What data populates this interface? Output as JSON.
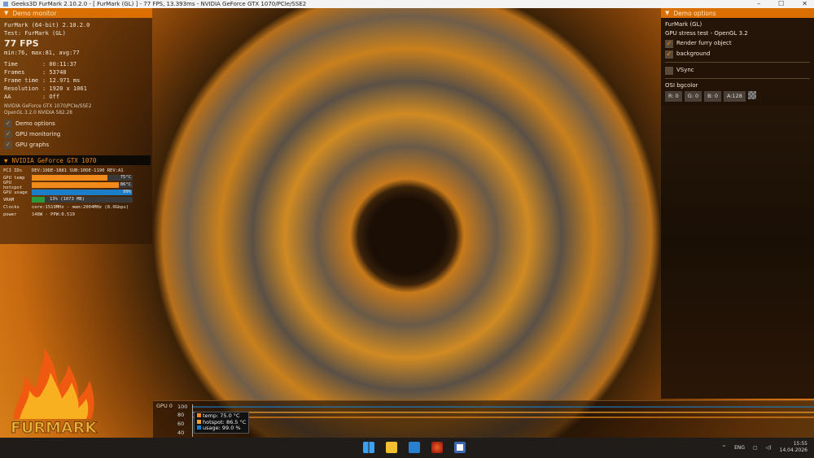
{
  "window": {
    "title": "Geeks3D FurMark 2.10.2.0 - [ FurMark (GL) ] - 77 FPS, 13.393ms - NVIDIA GeForce GTX 1070/PCIe/SSE2",
    "minimize": "–",
    "maximize": "☐",
    "close": "✕"
  },
  "monitor": {
    "header": "Demo monitor",
    "app": "FurMark (64-bit) 2.10.2.0",
    "test": "Test: FurMark (GL)",
    "fps": "77 FPS",
    "fps_stats": "min:76, max:81, avg:77",
    "stats": [
      {
        "k": "Time",
        "v": ": 00:11:37"
      },
      {
        "k": "Frames",
        "v": ": 53748"
      },
      {
        "k": "Frame time",
        "v": ": 12.971 ms"
      },
      {
        "k": "Resolution",
        "v": ": 1920 x 1061"
      },
      {
        "k": "AA",
        "v": ": Off"
      }
    ],
    "renderer": "NVIDIA GeForce GTX 1070/PCIe/SSE2",
    "gl": "OpenGL 3.2.0 NVIDIA 582.28",
    "checks": [
      {
        "label": "Demo options",
        "checked": true
      },
      {
        "label": "GPU monitoring",
        "checked": true
      },
      {
        "label": "GPU graphs",
        "checked": true
      }
    ]
  },
  "gpu": {
    "header": "NVIDIA GeForce GTX 1070",
    "pci_label": "PCI IDs",
    "pci": "DEV:10DE-1B81 SUB:10DE-1190 REV:A1",
    "bars": [
      {
        "k": "GPU temp",
        "v": "75°C",
        "pct": 75,
        "color": "#f08a1a"
      },
      {
        "k": "GPU hotspot",
        "v": "86°C",
        "pct": 86,
        "color": "#f08a1a"
      },
      {
        "k": "GPU usage",
        "v": "99%",
        "pct": 99,
        "color": "#1a7fc8"
      },
      {
        "k": "VRAM",
        "v": "13% (1073 MB)",
        "pct": 13,
        "color": "#2a9a3a"
      }
    ],
    "clocks_label": "Clocks",
    "clocks": "core:1519MHz - mem:2004MHz (8.0Gbps)",
    "power_label": "power",
    "power": "148W - PPW:0.519"
  },
  "options": {
    "header": "Demo options",
    "name": "FurMark (GL)",
    "desc": "GPU stress test - OpenGL 3.2",
    "checks": [
      {
        "label": "Render furry object",
        "checked": true
      },
      {
        "label": "background",
        "checked": true
      }
    ],
    "vsync": {
      "label": "VSync",
      "checked": false
    },
    "bgcolor_label": "OSI bgcolor",
    "bgcolor": [
      "R: 0",
      "G: 0",
      "B: 0",
      "A:128"
    ]
  },
  "graph": {
    "label": "GPU 0",
    "yticks": [
      "100",
      "80",
      "60",
      "40"
    ],
    "ylim": [
      30,
      105
    ],
    "series": [
      {
        "name": "temp: 75.0 °C",
        "value": 75,
        "color": "#f08a1a"
      },
      {
        "name": "hotspot: 86.5 °C",
        "value": 86.5,
        "color": "#f0a030"
      },
      {
        "name": "usage: 99.0 %",
        "value": 99,
        "color": "#1a7fc8"
      }
    ]
  },
  "logo": "FURMARK",
  "taskbar": {
    "lang": "ENG",
    "time": "15:55",
    "date": "14.04.2026",
    "apps": [
      "start",
      "file-explorer",
      "app",
      "furmark",
      "active-app"
    ]
  }
}
